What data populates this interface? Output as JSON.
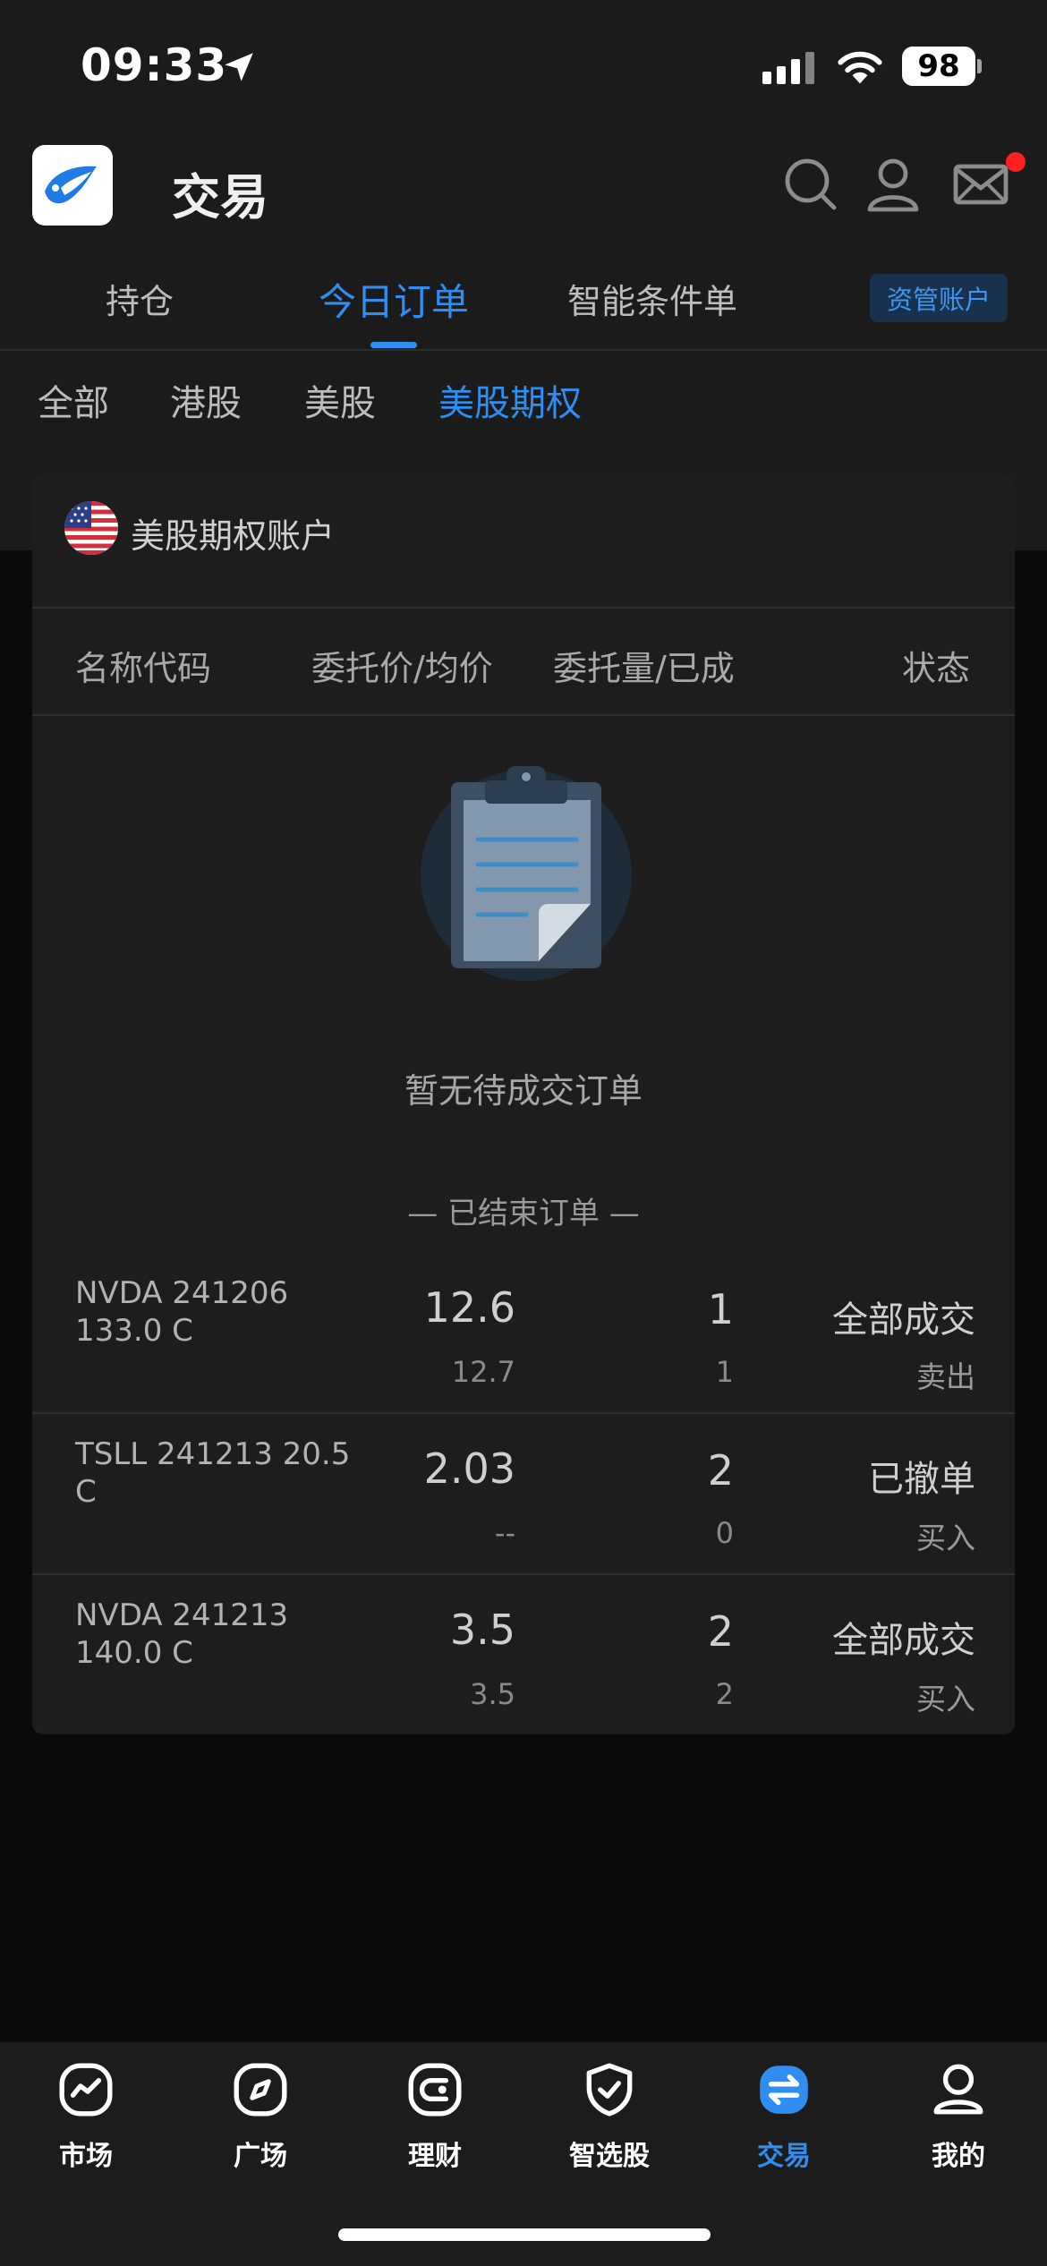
{
  "status_bar": {
    "time": "09:33",
    "battery": "98"
  },
  "header": {
    "title": "交易"
  },
  "tabs": [
    {
      "label": "持仓"
    },
    {
      "label": "今日订单"
    },
    {
      "label": "智能条件单"
    }
  ],
  "asset_account_label": "资管账户",
  "subtabs": [
    {
      "label": "全部"
    },
    {
      "label": "港股"
    },
    {
      "label": "美股"
    },
    {
      "label": "美股期权"
    }
  ],
  "account": {
    "title": "美股期权账户"
  },
  "columns": {
    "name": "名称代码",
    "price": "委托价/均价",
    "qty": "委托量/已成",
    "status": "状态"
  },
  "empty_state": {
    "text": "暂无待成交订单"
  },
  "finished_label": "— 已结束订单 —",
  "orders": [
    {
      "name": "NVDA 241206 133.0 C",
      "price": "12.6",
      "avg_price": "12.7",
      "qty": "1",
      "filled": "1",
      "status": "全部成交",
      "side": "卖出"
    },
    {
      "name": "TSLL 241213 20.5 C",
      "price": "2.03",
      "avg_price": "--",
      "qty": "2",
      "filled": "0",
      "status": "已撤单",
      "side": "买入"
    },
    {
      "name": "NVDA 241213 140.0 C",
      "price": "3.5",
      "avg_price": "3.5",
      "qty": "2",
      "filled": "2",
      "status": "全部成交",
      "side": "买入"
    }
  ],
  "bottom_nav": [
    {
      "label": "市场",
      "icon": "market-chart-icon"
    },
    {
      "label": "广场",
      "icon": "compass-icon"
    },
    {
      "label": "理财",
      "icon": "wallet-icon"
    },
    {
      "label": "智选股",
      "icon": "shield-check-icon"
    },
    {
      "label": "交易",
      "icon": "exchange-icon"
    },
    {
      "label": "我的",
      "icon": "profile-icon"
    }
  ],
  "colors": {
    "accent": "#2f8ef0",
    "background": "#0a0a0a",
    "surface": "#1d1d1d",
    "notification": "#ff2020"
  }
}
